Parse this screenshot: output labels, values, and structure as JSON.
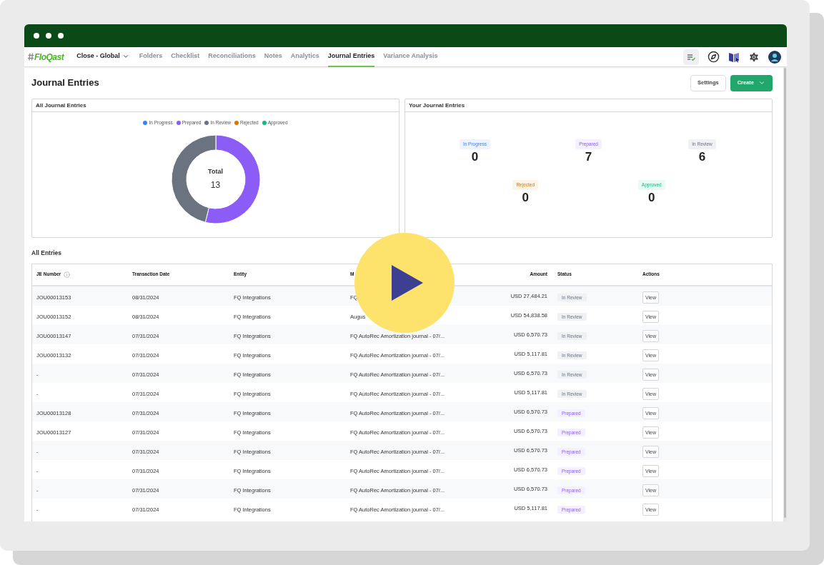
{
  "logo": {
    "text": "FloQast"
  },
  "nav": [
    {
      "label": "Close - Global",
      "kind": "dropdown",
      "selected": false
    },
    {
      "label": "Folders",
      "kind": "link",
      "selected": false
    },
    {
      "label": "Checklist",
      "kind": "link",
      "selected": false
    },
    {
      "label": "Reconciliations",
      "kind": "link",
      "selected": false
    },
    {
      "label": "Notes",
      "kind": "link",
      "selected": false
    },
    {
      "label": "Analytics",
      "kind": "link",
      "selected": false
    },
    {
      "label": "Journal Entries",
      "kind": "link",
      "selected": true
    },
    {
      "label": "Variance Analysis",
      "kind": "link",
      "selected": false
    }
  ],
  "page_title": "Journal Entries",
  "buttons": [
    {
      "label": "Settings",
      "kind": "secondary"
    },
    {
      "label": "Create",
      "kind": "primary"
    }
  ],
  "all_entries_card": {
    "title": "All Journal Entries",
    "legend": [
      {
        "color": "#3b82f6"
      },
      {
        "color": "#8b5cf6"
      },
      {
        "color": "#6b7280"
      },
      {
        "color": "#d97706"
      },
      {
        "color": "#10b981"
      }
    ],
    "total_label": "Total",
    "total_value": "13",
    "chart_data": {
      "type": "donut",
      "categories": [
        "In Progress",
        "Prepared",
        "In Review",
        "Rejected",
        "Approved"
      ],
      "values": [
        0,
        53.8,
        46.2,
        0,
        0
      ]
    }
  },
  "your_entries_card": {
    "title": "Your Journal Entries",
    "tiles": [
      {
        "label": "In Progress",
        "kind": "in_progress",
        "value": "0"
      },
      {
        "label": "Prepared",
        "kind": "prepared",
        "value": "7"
      },
      {
        "label": "In Review",
        "kind": "in_review",
        "value": "6"
      },
      {
        "label": "Rejected",
        "kind": "rejected",
        "value": "0"
      },
      {
        "label": "Approved",
        "kind": "approved",
        "value": "0"
      }
    ]
  },
  "table": {
    "title": "All Entries",
    "columns": [
      "JE Number",
      "Transaction Date",
      "Entity",
      "M",
      "Amount",
      "Status",
      "Actions"
    ],
    "rows": [
      {
        "je": "JOU00013153",
        "date": "08/31/2024",
        "entity": "FQ Integrations",
        "memo": "FQ",
        "amount": "USD 27,484.21",
        "status": {
          "label": "In Review",
          "kind": "in_review"
        },
        "action": "View"
      },
      {
        "je": "JOU00013152",
        "date": "08/31/2024",
        "entity": "FQ Integrations",
        "memo": "Augus",
        "amount": "USD 54,838.58",
        "status": {
          "label": "In Review",
          "kind": "in_review"
        },
        "action": "View"
      },
      {
        "je": "JOU00013147",
        "date": "07/31/2024",
        "entity": "FQ Integrations",
        "memo": "FQ AutoRec Amortization journal - 07/...",
        "amount": "USD 6,570.73",
        "status": {
          "label": "In Review",
          "kind": "in_review"
        },
        "action": "View"
      },
      {
        "je": "JOU00013132",
        "date": "07/31/2024",
        "entity": "FQ Integrations",
        "memo": "FQ AutoRec Amortization journal - 07/...",
        "amount": "USD 5,117.81",
        "status": {
          "label": "In Review",
          "kind": "in_review"
        },
        "action": "View"
      },
      {
        "je": "-",
        "date": "07/31/2024",
        "entity": "FQ Integrations",
        "memo": "FQ AutoRec Amortization journal - 07/...",
        "amount": "USD 6,570.73",
        "status": {
          "label": "In Review",
          "kind": "in_review"
        },
        "action": "View"
      },
      {
        "je": "-",
        "date": "07/31/2024",
        "entity": "FQ Integrations",
        "memo": "FQ AutoRec Amortization journal - 07/...",
        "amount": "USD 5,117.81",
        "status": {
          "label": "In Review",
          "kind": "in_review"
        },
        "action": "View"
      },
      {
        "je": "JOU00013128",
        "date": "07/31/2024",
        "entity": "FQ Integrations",
        "memo": "FQ AutoRec Amortization journal - 07/...",
        "amount": "USD 6,570.73",
        "status": {
          "label": "Prepared",
          "kind": "prepared"
        },
        "action": "View"
      },
      {
        "je": "JOU00013127",
        "date": "07/31/2024",
        "entity": "FQ Integrations",
        "memo": "FQ AutoRec Amortization journal - 07/...",
        "amount": "USD 6,570.73",
        "status": {
          "label": "Prepared",
          "kind": "prepared"
        },
        "action": "View"
      },
      {
        "je": "-",
        "date": "07/31/2024",
        "entity": "FQ Integrations",
        "memo": "FQ AutoRec Amortization journal - 07/...",
        "amount": "USD 6,570.73",
        "status": {
          "label": "Prepared",
          "kind": "prepared"
        },
        "action": "View"
      },
      {
        "je": "-",
        "date": "07/31/2024",
        "entity": "FQ Integrations",
        "memo": "FQ AutoRec Amortization journal - 07/...",
        "amount": "USD 6,570.73",
        "status": {
          "label": "Prepared",
          "kind": "prepared"
        },
        "action": "View"
      },
      {
        "je": "-",
        "date": "07/31/2024",
        "entity": "FQ Integrations",
        "memo": "FQ AutoRec Amortization journal - 07/...",
        "amount": "USD 6,570.73",
        "status": {
          "label": "Prepared",
          "kind": "prepared"
        },
        "action": "View"
      },
      {
        "je": "-",
        "date": "07/31/2024",
        "entity": "FQ Integrations",
        "memo": "FQ AutoRec Amortization journal - 07/...",
        "amount": "USD 5,117.81",
        "status": {
          "label": "Prepared",
          "kind": "prepared"
        },
        "action": "View"
      }
    ]
  }
}
